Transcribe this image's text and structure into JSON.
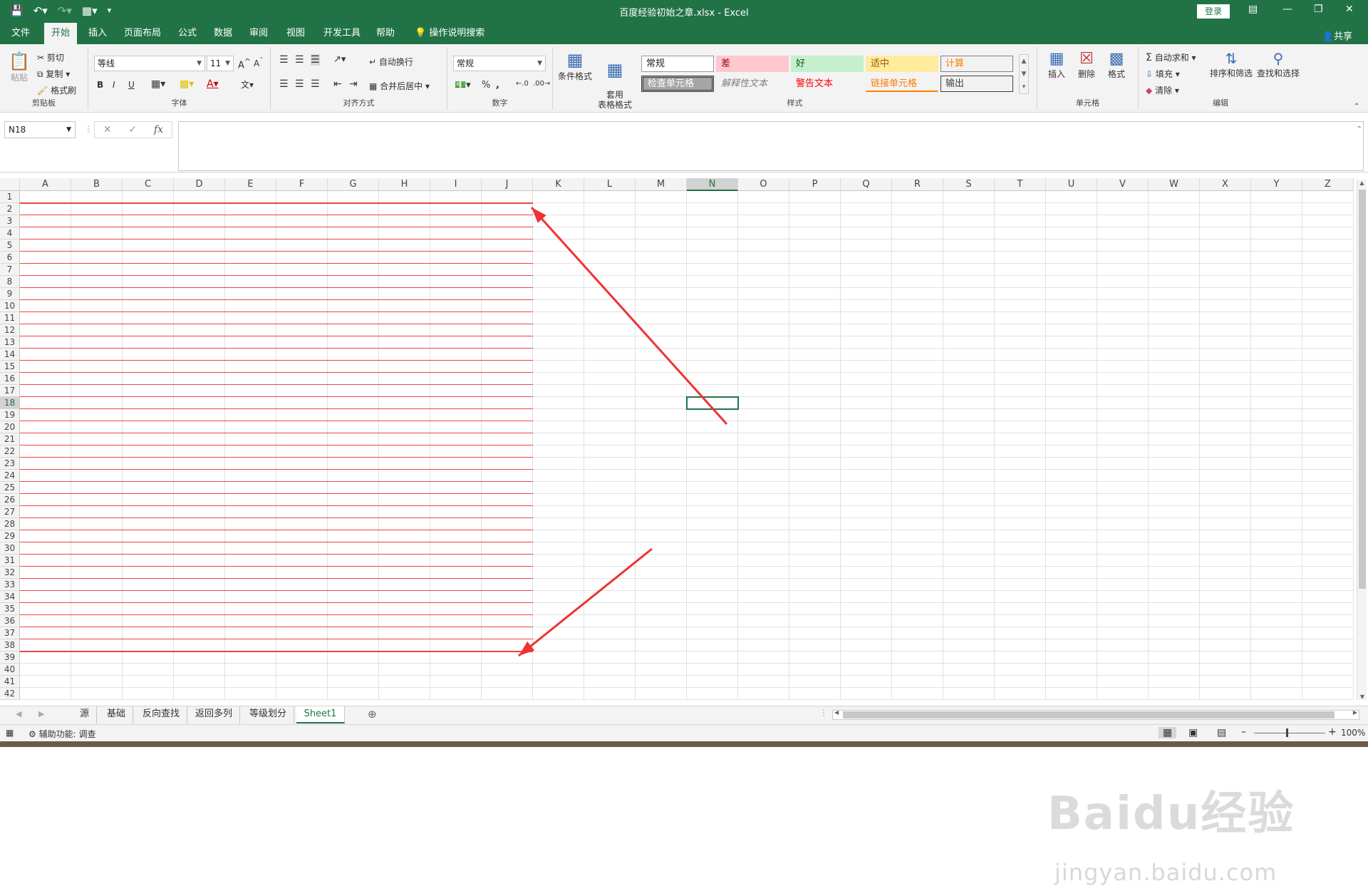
{
  "titlebar": {
    "title": "百度经验初始之章.xlsx  -  Excel",
    "login_label": "登录",
    "qat_icons": [
      "save-icon",
      "undo-icon",
      "redo-icon",
      "form-icon",
      "customize-icon"
    ]
  },
  "tabs": [
    {
      "label": "文件"
    },
    {
      "label": "开始"
    },
    {
      "label": "插入"
    },
    {
      "label": "页面布局"
    },
    {
      "label": "公式"
    },
    {
      "label": "数据"
    },
    {
      "label": "审阅"
    },
    {
      "label": "视图"
    },
    {
      "label": "开发工具"
    },
    {
      "label": "帮助"
    }
  ],
  "tell_me": "操作说明搜索",
  "share_label": "共享",
  "ribbon": {
    "clipboard": {
      "paste": "粘贴",
      "cut": "剪切",
      "copy": "复制",
      "format_painter": "格式刷",
      "label": "剪贴板"
    },
    "font": {
      "name": "等线",
      "size": "11",
      "label": "字体",
      "bold": "B",
      "italic": "I",
      "underline": "U"
    },
    "alignment": {
      "wrap": "自动换行",
      "merge": "合并后居中",
      "label": "对齐方式"
    },
    "number": {
      "format": "常规",
      "percent": "%",
      "comma": ",",
      "label": "数字"
    },
    "styles": {
      "conditional": "条件格式",
      "table_format": "套用\n表格格式",
      "label": "样式",
      "boxes": [
        {
          "text": "常规",
          "bg": "#ffffff",
          "color": "#222222"
        },
        {
          "text": "差",
          "bg": "#ffc7ce",
          "color": "#9c0006"
        },
        {
          "text": "好",
          "bg": "#c6efce",
          "color": "#006100"
        },
        {
          "text": "适中",
          "bg": "#ffeb9c",
          "color": "#9c5700"
        },
        {
          "text": "计算",
          "bg": "#f2f2f2",
          "color": "#fa7d00"
        },
        {
          "text": "检查单元格",
          "bg": "#a5a5a5",
          "color": "#ffffff"
        },
        {
          "text": "解释性文本",
          "bg": "#f3f3f3",
          "color": "#7f7f7f"
        },
        {
          "text": "警告文本",
          "bg": "#f3f3f3",
          "color": "#ff0000"
        },
        {
          "text": "链接单元格",
          "bg": "#f3f3f3",
          "color": "#fa7d00"
        },
        {
          "text": "输出",
          "bg": "#f2f2f2",
          "color": "#3f3f3f"
        }
      ]
    },
    "cells": {
      "insert": "插入",
      "delete": "删除",
      "format": "格式",
      "label": "单元格"
    },
    "editing": {
      "autosum": "自动求和",
      "fill": "填充",
      "clear": "清除",
      "sort": "排序和筛选",
      "find": "查找和选择",
      "label": "编辑"
    }
  },
  "formula_bar": {
    "name_box": "N18",
    "fx": "fx",
    "value": ""
  },
  "columns": [
    "A",
    "B",
    "C",
    "D",
    "E",
    "F",
    "G",
    "H",
    "I",
    "J",
    "K",
    "L",
    "M",
    "N",
    "O",
    "P",
    "Q",
    "R",
    "S",
    "T",
    "U",
    "V",
    "W",
    "X",
    "Y",
    "Z"
  ],
  "selected_column": "N",
  "selected_row": 18,
  "row_count": 42,
  "red_border_rows": {
    "first": 1,
    "last": 38,
    "col_start": "A",
    "col_end": "J"
  },
  "sheets": [
    {
      "label": "源"
    },
    {
      "label": "基础"
    },
    {
      "label": "反向查找"
    },
    {
      "label": "返回多列"
    },
    {
      "label": "等级划分"
    },
    {
      "label": "Sheet1",
      "active": true
    }
  ],
  "status": {
    "accessibility": "辅助功能: 调查",
    "zoom": "100%"
  },
  "watermark": {
    "logo": "Baidu经验",
    "url": "jingyan.baidu.com"
  }
}
